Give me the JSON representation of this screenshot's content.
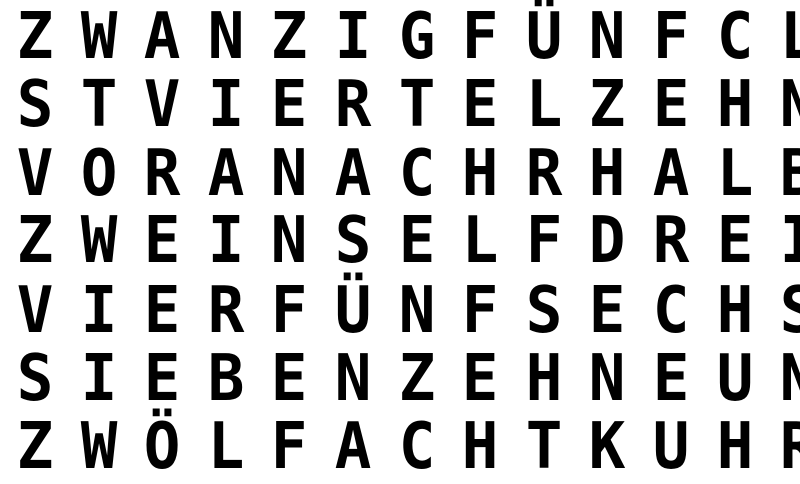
{
  "clock": {
    "rows": [
      "ZWANZIGFÜNFCL",
      "STVIERTELZEHN",
      "VORANACHRHALB",
      "ZWEINSELFDREI",
      "VIERFÜNFSECHS",
      "SIEBENZEHNEUN",
      "ZWÖLFACHTKUHR"
    ]
  },
  "colors": {
    "background": "#ffffff",
    "text": "#000000"
  }
}
